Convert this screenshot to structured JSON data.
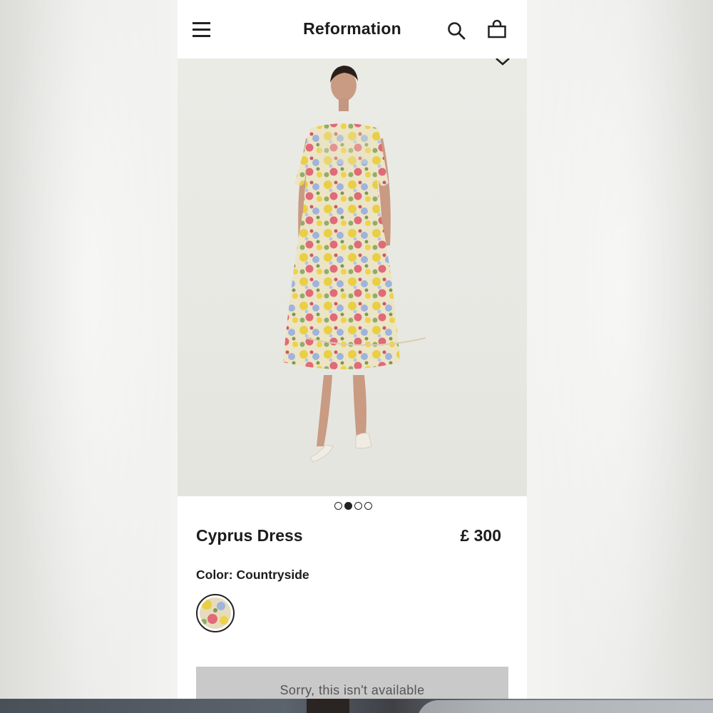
{
  "header": {
    "brand": "Reformation",
    "menu_icon": "menu-icon",
    "search_icon": "search-icon",
    "bag_icon": "shopping-bag-icon"
  },
  "gallery": {
    "image_count": 4,
    "active_index": 1,
    "expand_icon": "chevron-down-icon"
  },
  "product": {
    "name": "Cyprus Dress",
    "price": "£ 300",
    "color_label": "Color:",
    "color_value": "Countryside"
  },
  "actions": {
    "unavailable_label": "Sorry, this isn't available"
  },
  "colors": {
    "text": "#1c1c1c",
    "button_disabled_bg": "#c9c9c9",
    "button_disabled_text": "#555555"
  }
}
